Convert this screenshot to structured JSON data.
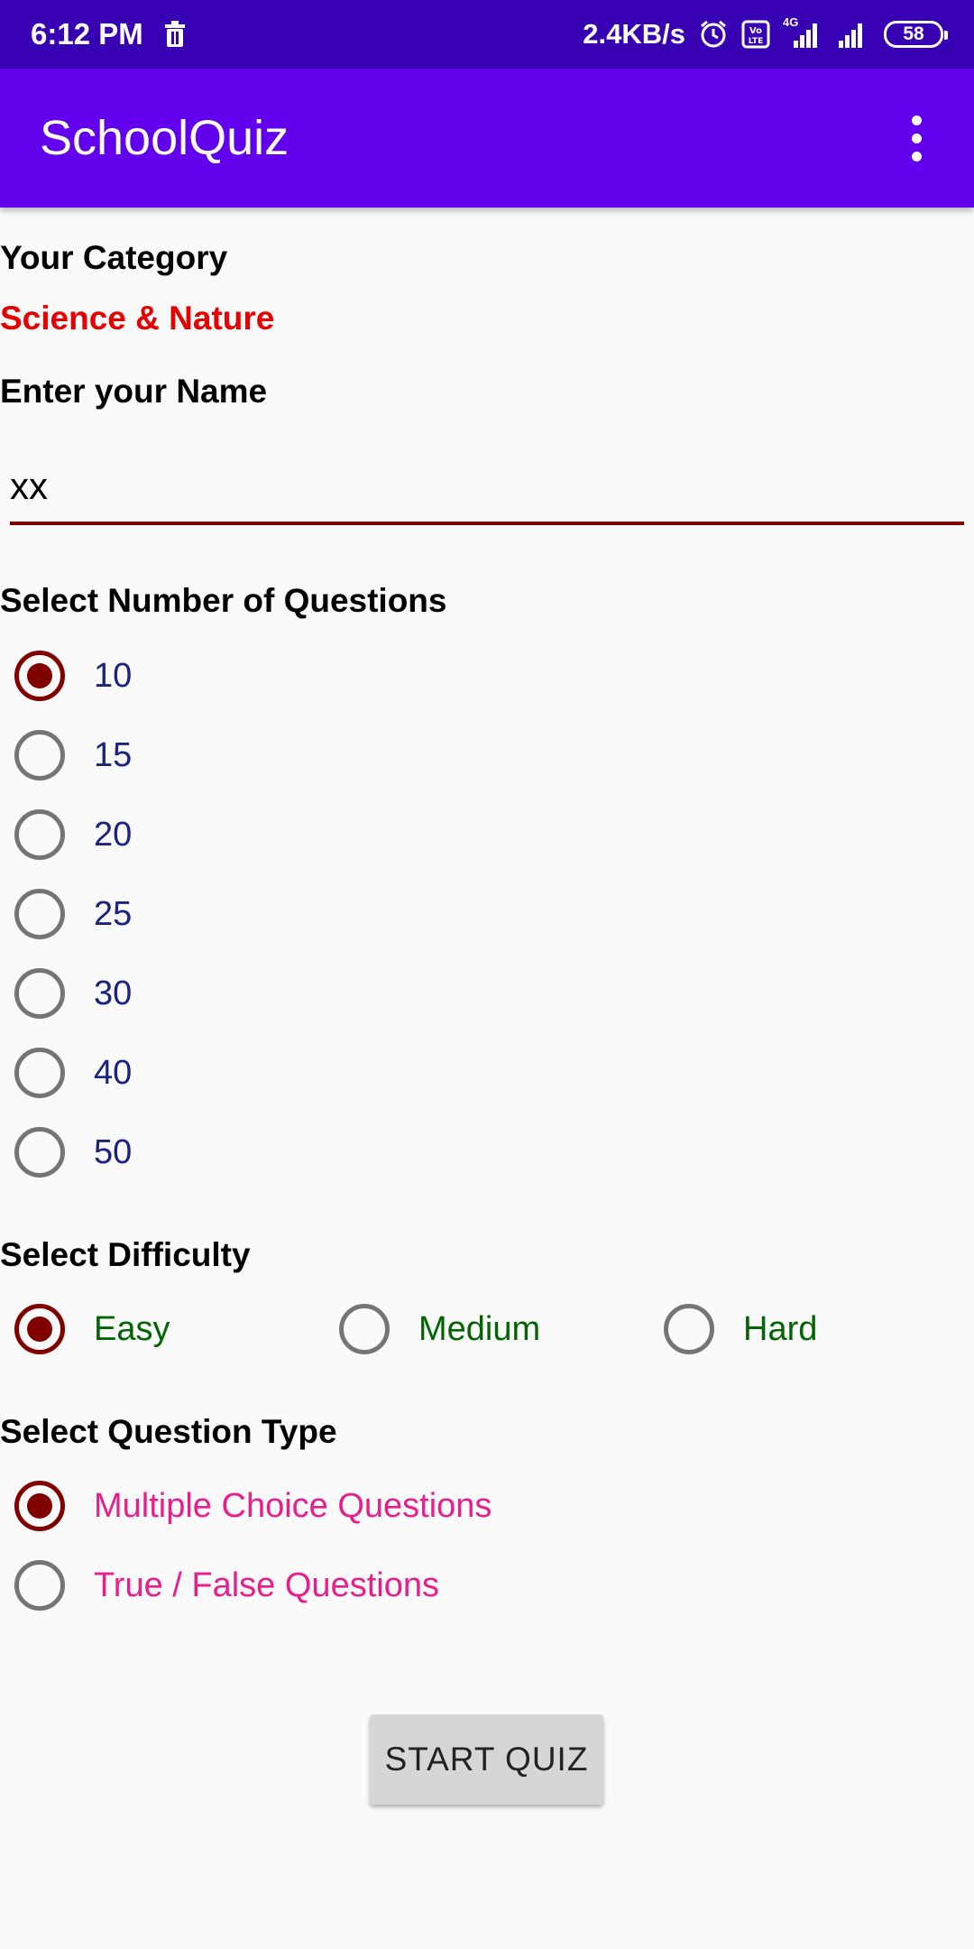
{
  "status_bar": {
    "time": "6:12 PM",
    "speed": "2.4KB/s",
    "network": "4G",
    "battery": "58",
    "icons": [
      "trash-icon",
      "alarm-icon",
      "volte-icon",
      "signal-icon",
      "signal-icon",
      "battery-icon"
    ]
  },
  "app_bar": {
    "title": "SchoolQuiz",
    "menu_icon": "overflow-menu-icon"
  },
  "category": {
    "label": "Your Category",
    "value": "Science & Nature",
    "value_color": "#e60000"
  },
  "name": {
    "label": "Enter your Name",
    "value": "xx"
  },
  "questions": {
    "label": "Select Number of Questions",
    "options": [
      "10",
      "15",
      "20",
      "25",
      "30",
      "40",
      "50"
    ],
    "selected": "10"
  },
  "difficulty": {
    "label": "Select Difficulty",
    "options": [
      "Easy",
      "Medium",
      "Hard"
    ],
    "selected": "Easy"
  },
  "question_type": {
    "label": "Select Question Type",
    "options": [
      "Multiple Choice Questions",
      "True / False Questions"
    ],
    "selected": "Multiple Choice Questions"
  },
  "start_button": {
    "label": "START QUIZ"
  },
  "colors": {
    "status_bar": "#3700b3",
    "app_bar": "#6200ee",
    "radio_checked": "#800000",
    "question_text": "#1a237e",
    "difficulty_text": "#006400",
    "type_text": "#e91e8c"
  }
}
